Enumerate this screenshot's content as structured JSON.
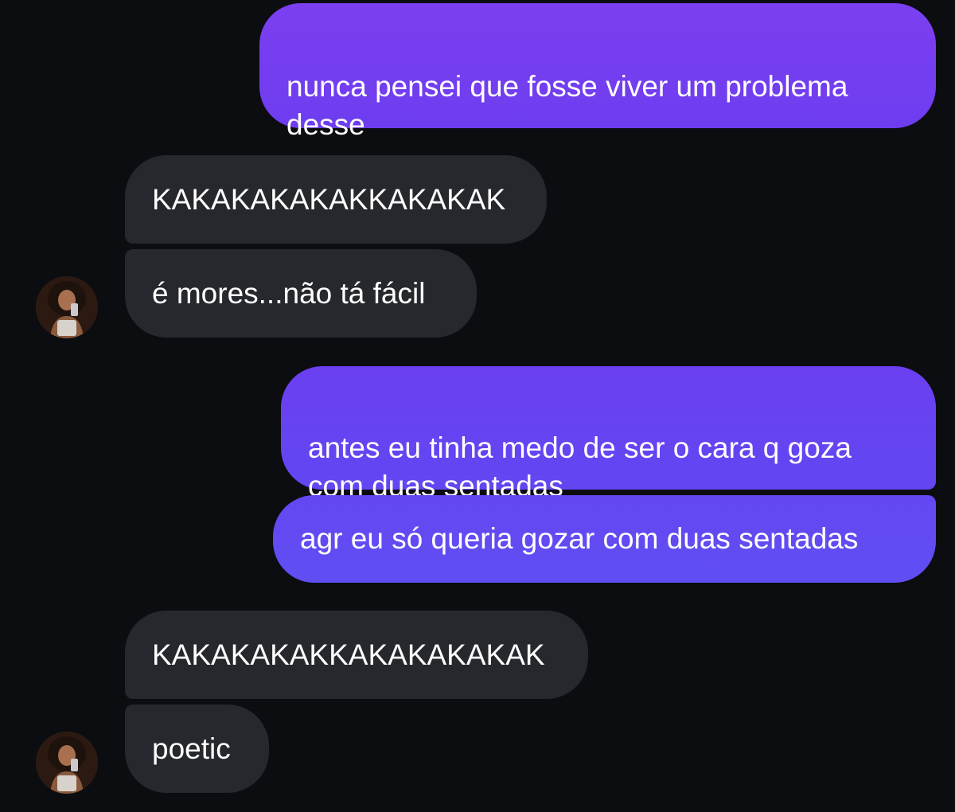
{
  "conversation": {
    "messages": [
      {
        "direction": "outgoing",
        "text": "nunca pensei que fosse viver um problema\ndesse"
      },
      {
        "direction": "incoming",
        "text": "KAKAKAKAKAKKAKAKAK"
      },
      {
        "direction": "incoming",
        "text": "é mores...não tá fácil"
      },
      {
        "direction": "outgoing",
        "text": "antes eu tinha medo de ser o cara q goza\ncom duas sentadas"
      },
      {
        "direction": "outgoing",
        "text": "agr eu só queria gozar com duas sentadas"
      },
      {
        "direction": "incoming",
        "text": "KAKAKAKAKKAKAKAKAKAK"
      },
      {
        "direction": "incoming",
        "text": "poetic"
      }
    ],
    "contact_avatar": {
      "icon": "profile-photo-avatar"
    }
  },
  "colors": {
    "background": "#0c0d11",
    "outgoing_bubble_top": "#7b3ff0",
    "outgoing_bubble_bottom": "#604ef3",
    "incoming_bubble": "#26282d",
    "text": "#ffffff"
  }
}
